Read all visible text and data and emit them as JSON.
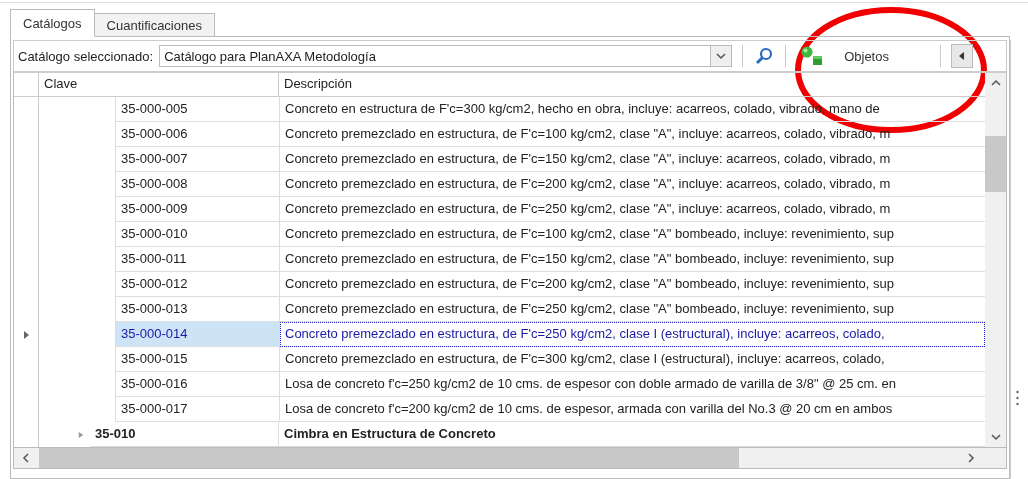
{
  "tabs": [
    {
      "label": "Catálogos",
      "selected": true
    },
    {
      "label": "Cuantificaciones",
      "selected": false
    }
  ],
  "toolbar": {
    "label": "Catálogo seleccionado:",
    "catalog_value": "Catálogo para PlanAXA Metodología",
    "objects_button": "Objetos"
  },
  "table": {
    "columns": [
      "Clave",
      "Descripción"
    ],
    "rows": [
      {
        "kind": "item",
        "selected": false,
        "clave": "35-000-005",
        "descripcion": "Concreto en estructura de F'c=300 kg/cm2, hecho en obra, incluye: acarreos, colado, vibrado, mano de"
      },
      {
        "kind": "item",
        "selected": false,
        "clave": "35-000-006",
        "descripcion": "Concreto premezclado en estructura, de F'c=100 kg/cm2, clase \"A\", incluye: acarreos, colado, vibrado, m"
      },
      {
        "kind": "item",
        "selected": false,
        "clave": "35-000-007",
        "descripcion": "Concreto premezclado en estructura, de F'c=150 kg/cm2, clase \"A\", incluye: acarreos, colado, vibrado, m"
      },
      {
        "kind": "item",
        "selected": false,
        "clave": "35-000-008",
        "descripcion": "Concreto premezclado en estructura, de F'c=200 kg/cm2, clase \"A\", incluye: acarreos, colado, vibrado, m"
      },
      {
        "kind": "item",
        "selected": false,
        "clave": "35-000-009",
        "descripcion": "Concreto premezclado en estructura, de F'c=250 kg/cm2, clase \"A\", incluye: acarreos, colado, vibrado, m"
      },
      {
        "kind": "item",
        "selected": false,
        "clave": "35-000-010",
        "descripcion": "Concreto premezclado en estructura, de F'c=100 kg/cm2, clase \"A\" bombeado, incluye: revenimiento, sup"
      },
      {
        "kind": "item",
        "selected": false,
        "clave": "35-000-011",
        "descripcion": "Concreto premezclado en estructura, de F'c=150 kg/cm2, clase \"A\" bombeado, incluye: revenimiento, sup"
      },
      {
        "kind": "item",
        "selected": false,
        "clave": "35-000-012",
        "descripcion": "Concreto premezclado en estructura, de F'c=200 kg/cm2, clase \"A\" bombeado, incluye: revenimiento, sup"
      },
      {
        "kind": "item",
        "selected": false,
        "clave": "35-000-013",
        "descripcion": "Concreto premezclado en estructura, de F'c=250 kg/cm2, clase \"A\" bombeado, incluye: revenimiento, sup"
      },
      {
        "kind": "item",
        "selected": true,
        "clave": "35-000-014",
        "descripcion": "Concreto premezclado en estructura, de F'c=250 kg/cm2, clase I (estructural), incluye: acarreos, colado,"
      },
      {
        "kind": "item",
        "selected": false,
        "clave": "35-000-015",
        "descripcion": "Concreto premezclado en estructura, de F'c=300 kg/cm2, clase I (estructural), incluye: acarreos, colado,"
      },
      {
        "kind": "item",
        "selected": false,
        "clave": "35-000-016",
        "descripcion": "Losa de concreto f'c=250 kg/cm2 de 10 cms. de espesor con doble armado de varilla de 3/8\" @ 25 cm. en"
      },
      {
        "kind": "item",
        "selected": false,
        "clave": "35-000-017",
        "descripcion": "Losa de concreto f'c=200 kg/cm2 de 10 cms. de espesor, armada con varilla del No.3 @ 20 cm en ambos"
      },
      {
        "kind": "group",
        "selected": false,
        "expanded": false,
        "clave": "35-010",
        "descripcion": "Cimbra en Estructura de Concreto"
      }
    ]
  }
}
